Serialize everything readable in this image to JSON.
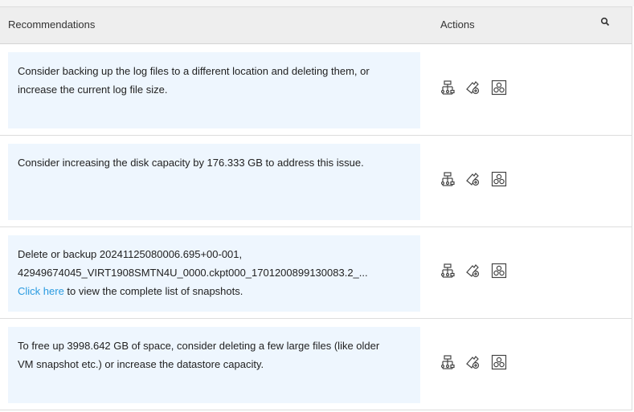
{
  "header": {
    "recommendations": "Recommendations",
    "actions": "Actions",
    "search_icon": "search-icon"
  },
  "rows": [
    {
      "line1": "Consider backing up the log files to a different location and deleting them, or",
      "line2": "increase the current log file size.",
      "line3": ""
    },
    {
      "line1": "Consider increasing the disk capacity by 176.333 GB to address this issue.",
      "line2": "",
      "line3": ""
    },
    {
      "line1": "Delete or backup 20241125080006.695+00-001,",
      "line2": "42949674045_VIRT1908SMTN4U_0000.ckpt000_1701200899130083.2_...",
      "link": "Click here",
      "line3": " to view the complete list of snapshots."
    },
    {
      "line1": "To free up 3998.642 GB of space, consider deleting a few large files (like older",
      "line2": "VM snapshot etc.) or increase the datastore capacity.",
      "line3": ""
    }
  ],
  "action_icons": [
    "workflow-icon",
    "remediate-icon",
    "gears-icon"
  ]
}
